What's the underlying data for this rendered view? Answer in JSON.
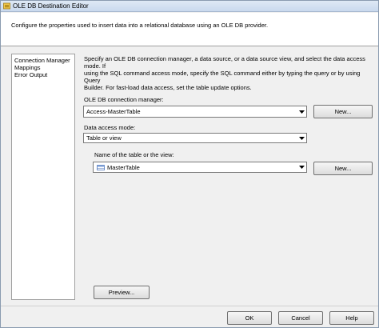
{
  "window": {
    "title": "OLE DB Destination Editor",
    "title_icon": "ssis-component-icon"
  },
  "header": {
    "text": "Configure the properties used to insert data into a relational database using an OLE DB provider."
  },
  "nav": {
    "items": [
      {
        "label": "Connection Manager",
        "selected": true
      },
      {
        "label": "Mappings",
        "selected": false
      },
      {
        "label": "Error Output",
        "selected": false
      }
    ]
  },
  "main": {
    "description": [
      "Specify an OLE DB connection manager, a data source, or a data source view, and select the data access mode. If",
      "using the SQL command access mode, specify the SQL command either by typing the query or by using Query",
      "Builder. For fast-load data access, set the table update options."
    ],
    "connection_manager_label": "OLE DB connection manager:",
    "connection_manager_value": "Access-MasterTable",
    "connection_new_label": "New...",
    "access_mode_label": "Data access mode:",
    "access_mode_value": "Table or view",
    "table_name_label": "Name of the table or the view:",
    "table_name_value": "MasterTable",
    "table_new_label": "New...",
    "preview_label": "Preview..."
  },
  "footer": {
    "ok_label": "OK",
    "cancel_label": "Cancel",
    "help_label": "Help"
  }
}
